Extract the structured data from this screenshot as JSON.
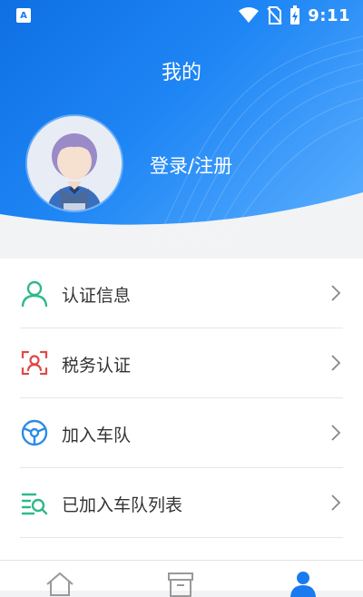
{
  "status_bar": {
    "time": "9:11",
    "left_icon_letter": "A"
  },
  "header": {
    "title": "我的",
    "login_label": "登录/注册"
  },
  "menu": {
    "items": [
      {
        "label": "认证信息",
        "icon": "user-icon",
        "color": "#2fb98a"
      },
      {
        "label": "税务认证",
        "icon": "face-scan-icon",
        "color": "#e04848"
      },
      {
        "label": "加入车队",
        "icon": "steering-wheel-icon",
        "color": "#2b8be8"
      },
      {
        "label": "已加入车队列表",
        "icon": "list-search-icon",
        "color": "#2fb98a"
      }
    ]
  },
  "tabbar": {
    "tabs": [
      {
        "icon": "home-icon",
        "active": false
      },
      {
        "icon": "box-icon",
        "active": false
      },
      {
        "icon": "profile-icon",
        "active": true
      }
    ]
  },
  "colors": {
    "accent": "#1a7af0",
    "header_start": "#0e6fe3",
    "header_end": "#5fb2ff"
  }
}
